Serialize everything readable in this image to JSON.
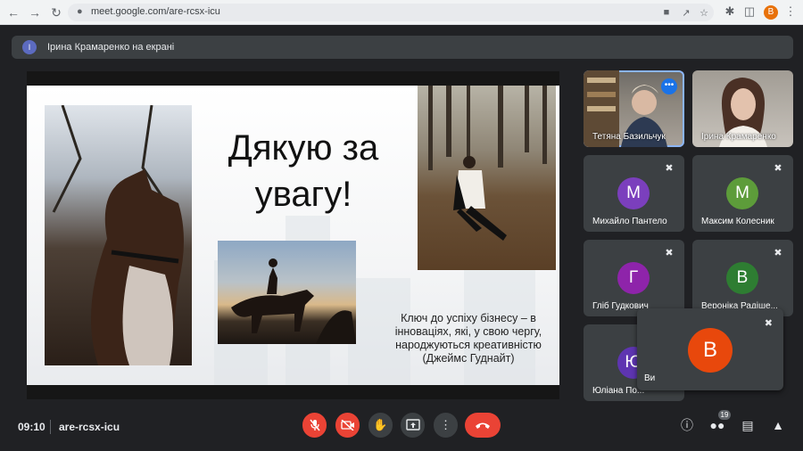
{
  "browser": {
    "url": "meet.google.com/are-rcsx-icu",
    "profile_initial": "B",
    "icons": [
      "back-icon",
      "forward-icon",
      "reload-icon",
      "camera-icon",
      "share-icon",
      "star-icon",
      "extensions-icon",
      "sidebar-icon",
      "menu-icon"
    ]
  },
  "banner": {
    "avatar_initial": "І",
    "text": "Ірина Крамаренко на екрані"
  },
  "slide": {
    "title": "Дякую за увагу!",
    "quote": "Ключ до успіху бізнесу – в інноваціях, які, у свою чергу, народжуються креативністю (Джеймс Гуднайт)"
  },
  "participants": [
    {
      "name": "Тетяна Базильчук",
      "type": "video"
    },
    {
      "name": "Ірина Крамаренко",
      "type": "video"
    },
    {
      "name": "Михайло Пантело",
      "initial": "М",
      "color": "#7b3fbd"
    },
    {
      "name": "Максим Колесник",
      "initial": "М",
      "color": "#5d9c3a"
    },
    {
      "name": "Гліб Гудкович",
      "initial": "Г",
      "color": "#8e24aa"
    },
    {
      "name": "Вероніка Радіше...",
      "initial": "В",
      "color": "#2e7d32"
    },
    {
      "name": "Юліана По...",
      "initial": "Ю",
      "color": "#5e35b1"
    }
  ],
  "self_view": {
    "initial": "B",
    "name_fragment": "Ви"
  },
  "bottom": {
    "time": "09:10",
    "meeting_code": "are-rcsx-icu",
    "people_count": "19"
  }
}
